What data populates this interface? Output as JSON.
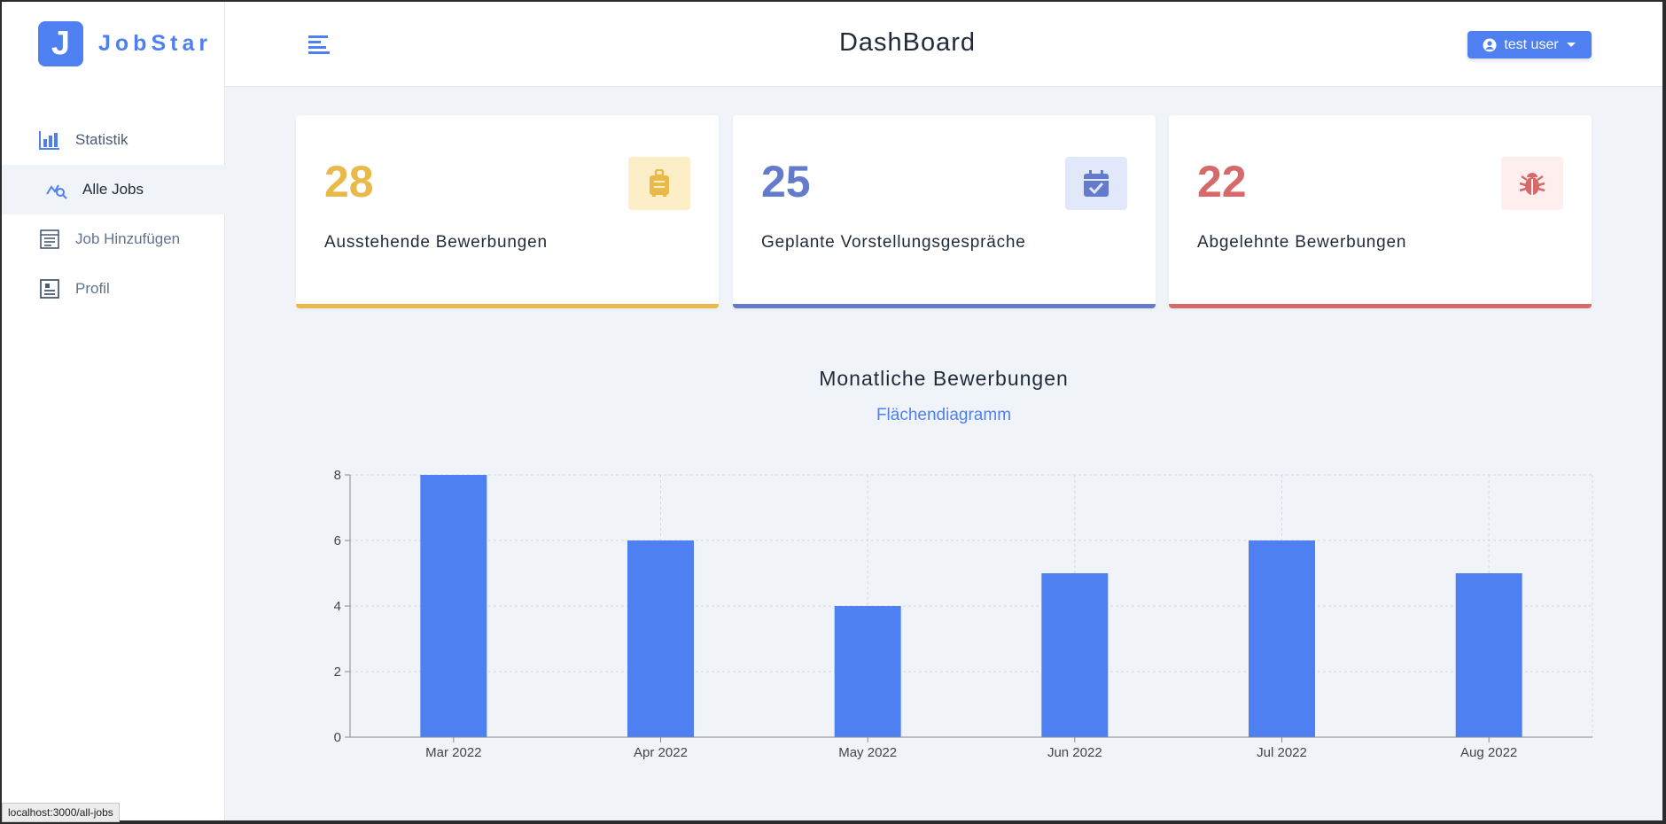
{
  "app": {
    "logo_letter": "J",
    "logo_name": "JobStar"
  },
  "header": {
    "title": "DashBoard",
    "user_label": "test user"
  },
  "sidebar": {
    "items": [
      {
        "label": "Statistik",
        "icon": "bar-chart-icon"
      },
      {
        "label": "Alle Jobs",
        "icon": "search-chart-icon"
      },
      {
        "label": "Job Hinzufügen",
        "icon": "form-icon"
      },
      {
        "label": "Profil",
        "icon": "profile-card-icon"
      }
    ]
  },
  "stats": [
    {
      "count": "28",
      "label": "Ausstehende Bewerbungen",
      "color": "#e9b949",
      "bg": "#fcefc7",
      "icon": "suitcase-icon"
    },
    {
      "count": "25",
      "label": "Geplante Vorstellungsgespräche",
      "color": "#647acb",
      "bg": "#e0e8f9",
      "icon": "calendar-check-icon"
    },
    {
      "count": "22",
      "label": "Abgelehnte Bewerbungen",
      "color": "#d66a6a",
      "bg": "#ffeeee",
      "icon": "bug-icon"
    }
  ],
  "chart_section": {
    "title": "Monatliche Bewerbungen",
    "toggle_label": "Flächendiagramm"
  },
  "chart_data": {
    "type": "bar",
    "categories": [
      "Mar 2022",
      "Apr 2022",
      "May 2022",
      "Jun 2022",
      "Jul 2022",
      "Aug 2022"
    ],
    "values": [
      8,
      6,
      4,
      5,
      6,
      5
    ],
    "ylim": [
      0,
      8
    ],
    "yticks": [
      0,
      2,
      4,
      6,
      8
    ],
    "grid": true,
    "bar_color": "#4f80f2"
  },
  "status_bar": {
    "url": "localhost:3000/all-jobs"
  },
  "colors": {
    "accent": "#4f80f2"
  }
}
